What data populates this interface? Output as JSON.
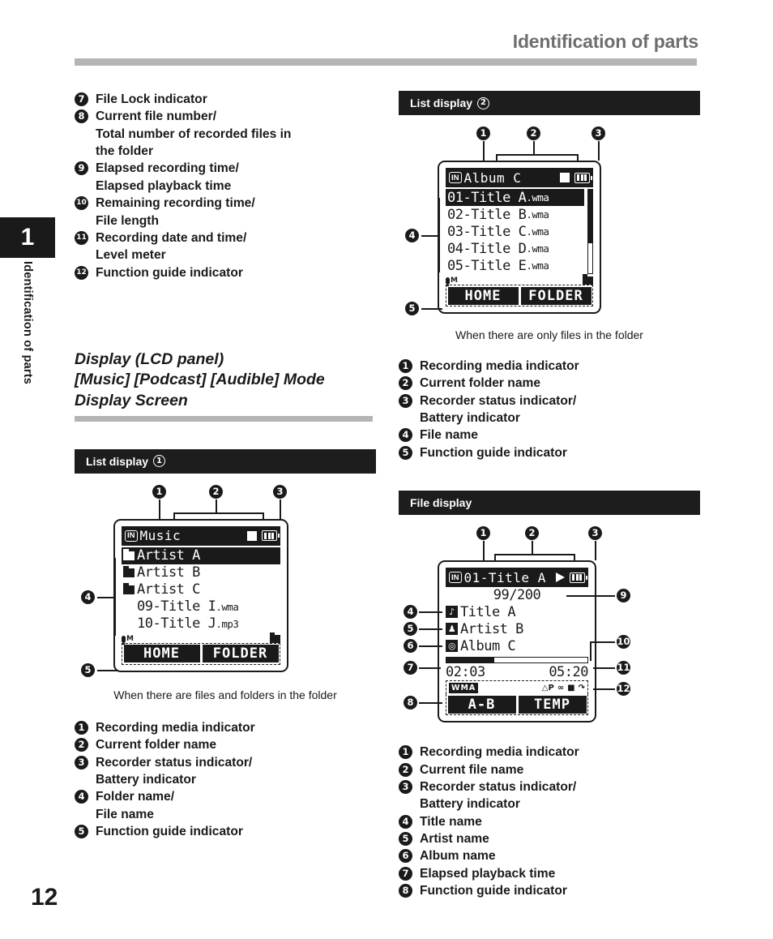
{
  "header": {
    "title": "Identification of parts"
  },
  "sidebar": {
    "chapter_number": "1",
    "chapter_label": "Identification of parts",
    "page_number": "12"
  },
  "left_column": {
    "top_list": [
      {
        "num": "7",
        "lines": [
          "File Lock indicator"
        ]
      },
      {
        "num": "8",
        "lines": [
          "Current file number/",
          "Total number of recorded files in",
          "the folder"
        ]
      },
      {
        "num": "9",
        "lines": [
          "Elapsed recording time/",
          "Elapsed playback time"
        ]
      },
      {
        "num": "10",
        "lines": [
          "Remaining recording time/",
          "File length"
        ]
      },
      {
        "num": "11",
        "lines": [
          "Recording date and time/",
          "Level meter"
        ]
      },
      {
        "num": "12",
        "lines": [
          "Function guide indicator"
        ]
      }
    ],
    "section_heading": [
      "Display (LCD panel)",
      "[Music] [Podcast] [Audible] Mode",
      "Display Screen"
    ],
    "bar": {
      "label": "List display",
      "circled": "1"
    },
    "caption": "When there are files and folders in the folder",
    "bottom_list": [
      {
        "num": "1",
        "lines": [
          "Recording media indicator"
        ]
      },
      {
        "num": "2",
        "lines": [
          "Current folder name"
        ]
      },
      {
        "num": "3",
        "lines": [
          "Recorder status indicator/",
          "Battery indicator"
        ]
      },
      {
        "num": "4",
        "lines": [
          "Folder name/",
          "File name"
        ]
      },
      {
        "num": "5",
        "lines": [
          "Function guide indicator"
        ]
      }
    ],
    "lcd": {
      "media_badge": "IN",
      "title": "Music",
      "status_icon": "stop-square-icon",
      "battery_icon": "battery-full-icon",
      "rows": [
        {
          "text": "Artist A",
          "icon": "folder-hollow-icon",
          "selected": true
        },
        {
          "text": "Artist B",
          "icon": "folder-filled-icon",
          "selected": false
        },
        {
          "text": "Artist C",
          "icon": "folder-filled-icon",
          "selected": false
        },
        {
          "text": "09-Title I",
          "ext": ".wma",
          "icon": "none",
          "selected": false
        },
        {
          "text": "10-Title J",
          "ext": ".mp3",
          "icon": "none",
          "selected": false
        }
      ],
      "mic_label": "M",
      "function_guide": {
        "left": "HOME",
        "right": "FOLDER"
      },
      "callouts": [
        "1",
        "2",
        "3",
        "4",
        "5"
      ]
    }
  },
  "right_column": {
    "bar_top": {
      "label": "List display",
      "circled": "2"
    },
    "caption_top": "When there are only files in the folder",
    "top_list": [
      {
        "num": "1",
        "lines": [
          "Recording media indicator"
        ]
      },
      {
        "num": "2",
        "lines": [
          "Current folder name"
        ]
      },
      {
        "num": "3",
        "lines": [
          "Recorder status indicator/",
          "Battery indicator"
        ]
      },
      {
        "num": "4",
        "lines": [
          "File name"
        ]
      },
      {
        "num": "5",
        "lines": [
          "Function guide indicator"
        ]
      }
    ],
    "bar_bottom": {
      "label": "File display",
      "circled": ""
    },
    "bottom_list": [
      {
        "num": "1",
        "lines": [
          "Recording media indicator"
        ]
      },
      {
        "num": "2",
        "lines": [
          "Current file name"
        ]
      },
      {
        "num": "3",
        "lines": [
          "Recorder status indicator/",
          "Battery indicator"
        ]
      },
      {
        "num": "4",
        "lines": [
          "Title name"
        ]
      },
      {
        "num": "5",
        "lines": [
          "Artist name"
        ]
      },
      {
        "num": "6",
        "lines": [
          "Album name"
        ]
      },
      {
        "num": "7",
        "lines": [
          "Elapsed playback time"
        ]
      },
      {
        "num": "8",
        "lines": [
          "Function guide indicator"
        ]
      }
    ],
    "lcd_list": {
      "media_badge": "IN",
      "title": "Album C",
      "status_icon": "stop-square-icon",
      "battery_icon": "battery-full-icon",
      "rows": [
        {
          "text": "01-Title A",
          "ext": ".wma",
          "selected": true
        },
        {
          "text": "02-Title B",
          "ext": ".wma",
          "selected": false
        },
        {
          "text": "03-Title C",
          "ext": ".wma",
          "selected": false
        },
        {
          "text": "04-Title D",
          "ext": ".wma",
          "selected": false
        },
        {
          "text": "05-Title E",
          "ext": ".wma",
          "selected": false
        }
      ],
      "mic_label": "M",
      "function_guide": {
        "left": "HOME",
        "right": "FOLDER"
      },
      "callouts": [
        "1",
        "2",
        "3",
        "4",
        "5"
      ]
    },
    "lcd_file": {
      "media_badge": "IN",
      "title": "01-Title A",
      "status_icon": "play-triangle-icon",
      "battery_icon": "battery-full-icon",
      "file_counter": "99/200",
      "title_name": "Title A",
      "artist_name": "Artist B",
      "album_name": "Album C",
      "title_icon": "music-note-icon",
      "artist_icon": "person-icon",
      "album_icon": "disc-icon",
      "progress_percent": 34,
      "elapsed_time": "02:03",
      "total_time": "05:20",
      "format_badge": "WMA",
      "indicator_icons": [
        "home-p-icon",
        "repeat-loop-icon",
        "folder-icon",
        "shuffle-arrow-icon"
      ],
      "function_guide": {
        "left": "A-B",
        "right": "TEMP"
      },
      "callouts": [
        "1",
        "2",
        "3",
        "4",
        "5",
        "6",
        "7",
        "8",
        "9",
        "10",
        "11",
        "12"
      ]
    }
  }
}
